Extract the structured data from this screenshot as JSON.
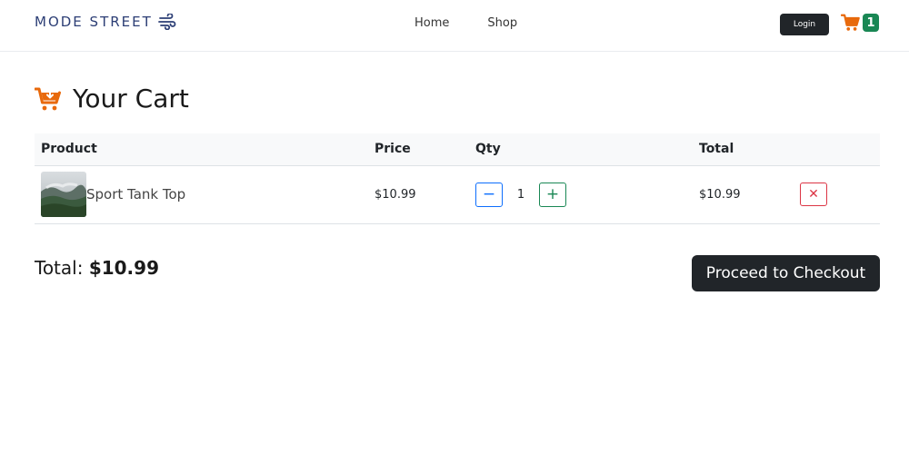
{
  "navbar": {
    "brand": "MODE STREET",
    "brand_icon": "wind-icon",
    "links": [
      "Home",
      "Shop"
    ],
    "login_label": "Login",
    "cart_icon": "shopping-cart-icon",
    "cart_count": "1",
    "badge_color": "#198754"
  },
  "page": {
    "title": "Your Cart",
    "title_icon": "cart-download-icon",
    "accent_color": "#e8690b"
  },
  "table": {
    "headers": [
      "Product",
      "Price",
      "Qty",
      "Total"
    ],
    "rows": [
      {
        "product_name": "Sport Tank Top",
        "thumbnail_icon": "product-thumbnail",
        "price": "$10.99",
        "qty": "1",
        "minus_label": "−",
        "plus_label": "+",
        "total": "$10.99",
        "remove_label": "✕"
      }
    ]
  },
  "summary": {
    "total_label": "Total:",
    "total_value": "$10.99",
    "checkout_label": "Proceed to Checkout"
  }
}
